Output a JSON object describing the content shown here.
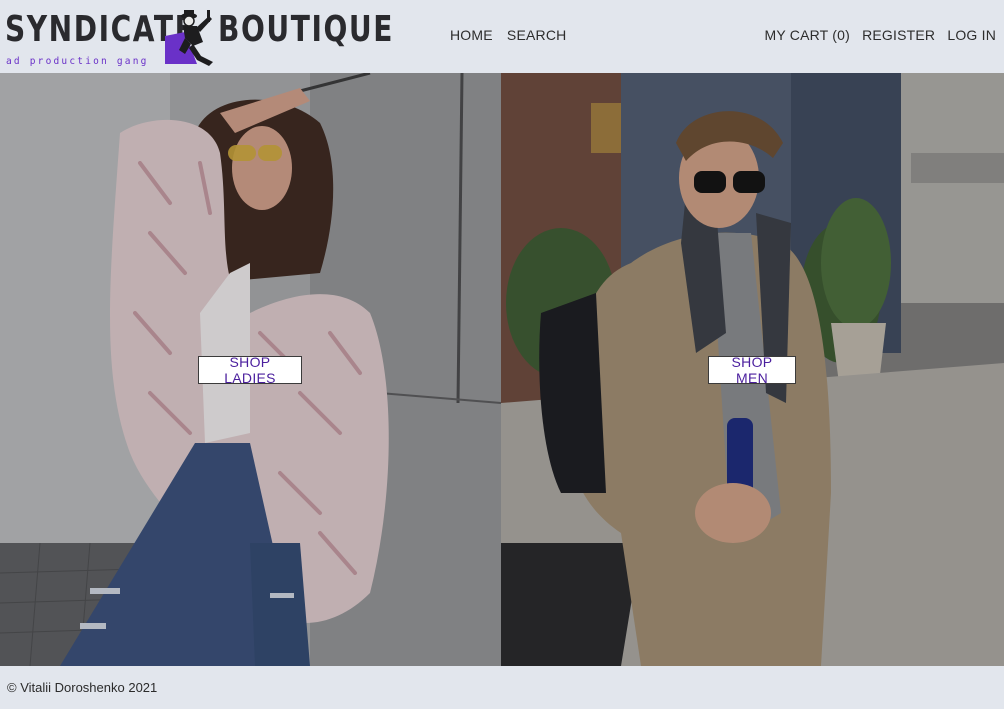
{
  "brand": {
    "word1": "SYNDICATE",
    "word2": "BOUTIQUE",
    "tagline": "ad production gang",
    "logo_icon": "gangster-figure-icon",
    "accent_color": "#6a31c8"
  },
  "nav": {
    "home": "HOME",
    "search": "SEARCH",
    "cart": "MY CART (0)",
    "register": "REGISTER",
    "login": "LOG IN"
  },
  "hero": {
    "ladies_button": "SHOP LADIES",
    "men_button": "SHOP MEN"
  },
  "footer": {
    "copyright": "© Vitalii Doroshenko 2021"
  }
}
